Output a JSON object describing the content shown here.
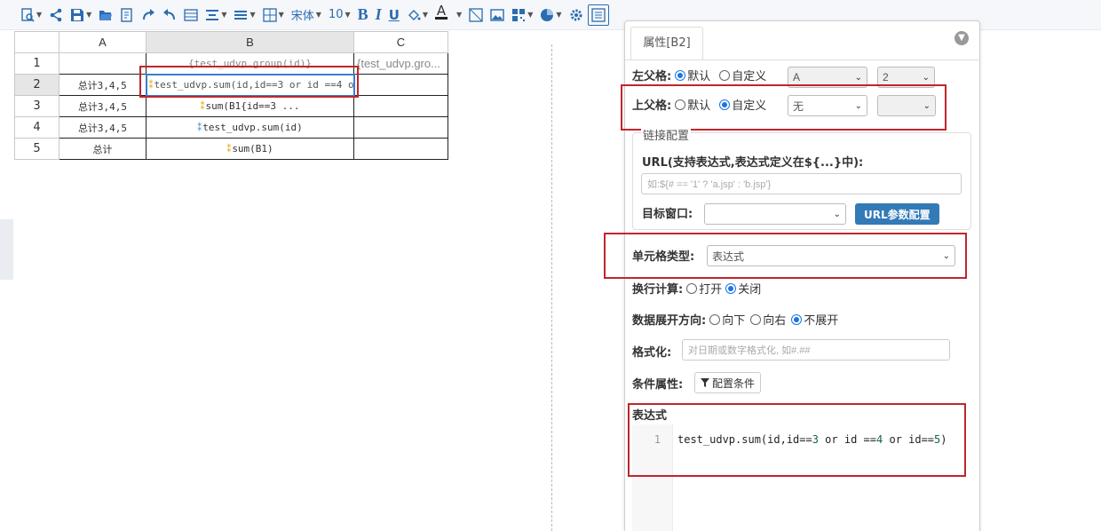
{
  "toolbar": {
    "items": [
      {
        "name": "preview-icon",
        "caret": true
      },
      {
        "name": "share-icon",
        "caret": false
      },
      {
        "name": "save-icon",
        "caret": true
      },
      {
        "name": "open-folder-icon",
        "caret": false
      },
      {
        "name": "import-icon",
        "caret": false
      },
      {
        "name": "redo-icon",
        "caret": false
      },
      {
        "name": "undo-icon",
        "caret": false
      },
      {
        "name": "merge-icon",
        "caret": false
      },
      {
        "name": "align-icon",
        "caret": true
      },
      {
        "name": "valign-icon",
        "caret": true
      },
      {
        "name": "border-icon",
        "caret": true
      }
    ],
    "font_name": "宋体",
    "font_size": "10",
    "bold": "B",
    "italic": "I",
    "underline": "U",
    "font_color_glyph": "A"
  },
  "sheet": {
    "columns": [
      "A",
      "B",
      "C"
    ],
    "rows": [
      {
        "num": "1",
        "a": "",
        "b": "{test_udvp.group(id)}",
        "c": "{test_udvp.gro..."
      },
      {
        "num": "2",
        "a": "总计3,4,5",
        "b": "test_udvp.sum(id,id==3 or id ==4 or i",
        "c": ""
      },
      {
        "num": "3",
        "a": "总计3,4,5",
        "b": "sum(B1{id==3 ...",
        "c": ""
      },
      {
        "num": "4",
        "a": "总计3,4,5",
        "b": "test_udvp.sum(id)",
        "c": ""
      },
      {
        "num": "5",
        "a": "总计",
        "b": "sum(B1)",
        "c": ""
      }
    ]
  },
  "panel": {
    "tab_title": "属性[B2]",
    "left_parent": {
      "label": "左父格:",
      "default_label": "默认",
      "custom_label": "自定义",
      "selected": "default",
      "col_value": "A",
      "row_value": "2"
    },
    "top_parent": {
      "label": "上父格:",
      "default_label": "默认",
      "custom_label": "自定义",
      "selected": "custom",
      "col_value": "无",
      "row_value": ""
    },
    "link": {
      "legend": "链接配置",
      "url_label": "URL(支持表达式,表达式定义在${...}中):",
      "url_placeholder": "如:${# == '1' ? 'a.jsp' : 'b.jsp'}",
      "target_label": "目标窗口:",
      "target_value": "",
      "param_button": "URL参数配置"
    },
    "cell_type": {
      "label": "单元格类型:",
      "value": "表达式"
    },
    "line_calc": {
      "label": "换行计算:",
      "on_label": "打开",
      "off_label": "关闭",
      "selected": "off"
    },
    "expand": {
      "label": "数据展开方向:",
      "down_label": "向下",
      "right_label": "向右",
      "none_label": "不展开",
      "selected": "none"
    },
    "format": {
      "label": "格式化:",
      "placeholder": "对日期或数字格式化, 如#.##"
    },
    "condition": {
      "label": "条件属性:",
      "button": "配置条件"
    },
    "expression": {
      "title": "表达式",
      "line_number": "1",
      "code_parts": [
        "test_udvp.sum(id,id==",
        "3",
        " or id ==",
        "4",
        " or id==",
        "5",
        ")"
      ]
    }
  }
}
